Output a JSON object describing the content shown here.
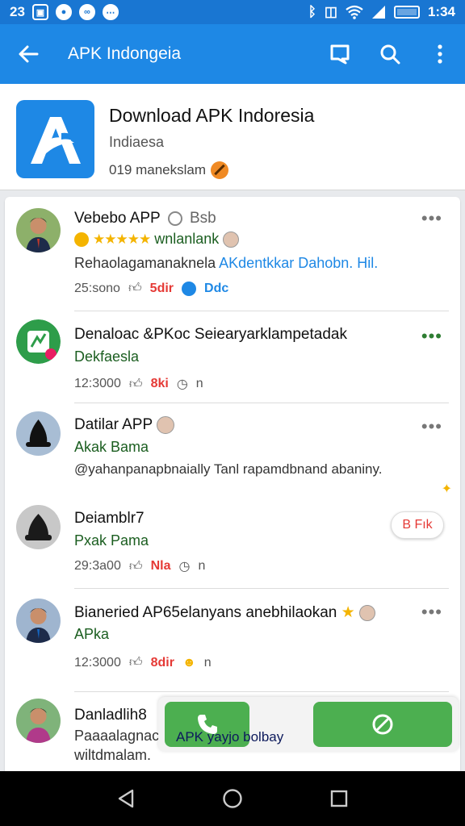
{
  "status_bar": {
    "time_left": "23",
    "time_right": "1:34"
  },
  "app_bar": {
    "title": "APK Indongeia"
  },
  "app_header": {
    "name": "Download APK Indoresia",
    "subtitle": "Indiaesa",
    "meta": "019 manekslam"
  },
  "posts": [
    {
      "name": "Vebebo APP",
      "name_suffix": "Bsb",
      "sub": "wnlanlank",
      "text": "Rehaolagamanaknela",
      "text_link": "AKdentkkar Dahobn. Hil.",
      "time": "25:sono",
      "likes": "5dir",
      "extra": "Ddc",
      "more": "•••"
    },
    {
      "name": "Denaloac &PKoc Seiearyarklampetadak",
      "sub": "Dekfaesla",
      "time": "12:3000",
      "likes": "8ki",
      "extra": "n",
      "more": "•••"
    },
    {
      "name": "Datilar APP",
      "sub": "Akak Bama",
      "text": "@yahanpanapbnaially Tanl rapamdbnand abaniny.",
      "more": "•••"
    },
    {
      "name": "Deiamblr7",
      "sub": "Pxak Pama",
      "time": "29:3a00",
      "likes": "Nla",
      "extra": "n",
      "button": "B Fık"
    },
    {
      "name": "Bianeried AP65elanyans anebhilaokan",
      "sub": "APka",
      "time": "12:3000",
      "likes": "8dir",
      "extra": "n",
      "more": "•••"
    },
    {
      "name": "Danladlih8",
      "text": "Paaaalagnac",
      "text2": "wiltdmalam."
    }
  ],
  "bottom_bar": {
    "call_label": "APK yayjo bolbay"
  },
  "colors": {
    "primary": "#1e88e5",
    "green": "#4caf50",
    "red": "#e53935"
  }
}
